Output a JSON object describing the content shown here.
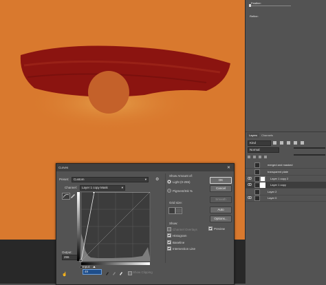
{
  "canvas": {
    "background_color": "#d9792e",
    "stroke_color": "#8b1410",
    "circle_color": "#c4612a"
  },
  "properties_panel": {
    "feather_label": "Feather:",
    "refine_label": "Refine:"
  },
  "layers_panel": {
    "tabs": [
      "Layers",
      "Channels"
    ],
    "active_tab": "Layers",
    "kind_label": "Kind",
    "blend_mode": "Normal",
    "layers": [
      {
        "name": "merged and masked",
        "visible": false,
        "selected": false
      },
      {
        "name": "transparent plate",
        "visible": false,
        "selected": false
      },
      {
        "name": "Layer 1 copy 2",
        "visible": true,
        "selected": false
      },
      {
        "name": "Layer 1 copy",
        "visible": true,
        "selected": true
      },
      {
        "name": "Layer 2",
        "visible": false,
        "selected": false
      },
      {
        "name": "Layer 0",
        "visible": true,
        "selected": false
      }
    ]
  },
  "curves_dialog": {
    "title": "Curves",
    "preset_label": "Preset:",
    "preset_value": "Custom",
    "channel_label": "Channel:",
    "channel_value": "Layer 1 copy Mask",
    "output_label": "Output:",
    "output_value": "255",
    "input_label": "Input:",
    "input_value": "49",
    "show_clipping_label": "Show Clipping",
    "show_amount_label": "Show Amount of:",
    "light_option": "Light  (0-255)",
    "pigment_option": "Pigment/Ink %",
    "grid_size_label": "Grid size:",
    "show_label": "Show:",
    "channel_overlays_label": "Channel Overlays",
    "histogram_label": "Histogram",
    "baseline_label": "Baseline",
    "intersection_label": "Intersection Line",
    "ok_label": "OK",
    "cancel_label": "Cancel",
    "smooth_label": "Smooth",
    "auto_label": "Auto",
    "options_label": "Options...",
    "preview_label": "Preview",
    "options": {
      "channel_overlays": false,
      "histogram": true,
      "baseline": true,
      "intersection_line": true,
      "preview": true
    }
  }
}
